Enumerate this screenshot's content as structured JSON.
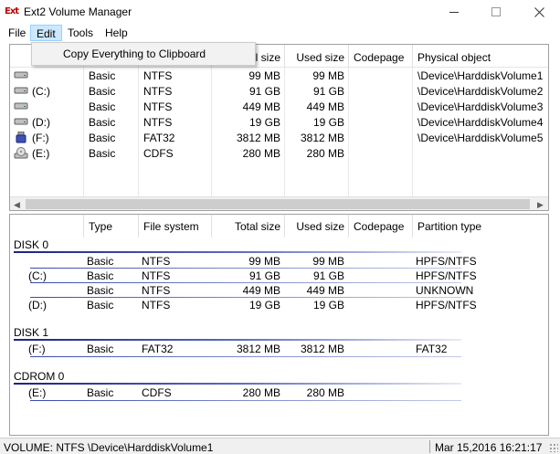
{
  "window": {
    "title": "Ext2 Volume Manager",
    "icon_text": "Ext"
  },
  "menu": {
    "file": "File",
    "edit": "Edit",
    "tools": "Tools",
    "help": "Help"
  },
  "dropdown": {
    "item": "Copy Everything to Clipboard"
  },
  "top_table": {
    "headers": {
      "total_size": "Total size",
      "used_size": "Used size",
      "codepage": "Codepage",
      "physical_object": "Physical object"
    },
    "rows": [
      {
        "icon": "hard-drive-icon",
        "name": "",
        "type": "Basic",
        "fs": "NTFS",
        "total": "99 MB",
        "used": "99 MB",
        "codepage": "",
        "physical": "\\Device\\HarddiskVolume1"
      },
      {
        "icon": "hard-drive-icon",
        "name": "(C:)",
        "type": "Basic",
        "fs": "NTFS",
        "total": "91 GB",
        "used": "91 GB",
        "codepage": "",
        "physical": "\\Device\\HarddiskVolume2"
      },
      {
        "icon": "hard-drive-icon",
        "name": "",
        "type": "Basic",
        "fs": "NTFS",
        "total": "449 MB",
        "used": "449 MB",
        "codepage": "",
        "physical": "\\Device\\HarddiskVolume3"
      },
      {
        "icon": "hard-drive-icon",
        "name": "(D:)",
        "type": "Basic",
        "fs": "NTFS",
        "total": "19 GB",
        "used": "19 GB",
        "codepage": "",
        "physical": "\\Device\\HarddiskVolume4"
      },
      {
        "icon": "usb-drive-icon",
        "name": "(F:)",
        "type": "Basic",
        "fs": "FAT32",
        "total": "3812 MB",
        "used": "3812 MB",
        "codepage": "",
        "physical": "\\Device\\HarddiskVolume5"
      },
      {
        "icon": "cdrom-drive-icon",
        "name": "(E:)",
        "type": "Basic",
        "fs": "CDFS",
        "total": "280 MB",
        "used": "280 MB",
        "codepage": "",
        "physical": ""
      }
    ]
  },
  "bottom_table": {
    "headers": {
      "type": "Type",
      "file_system": "File system",
      "total_size": "Total size",
      "used_size": "Used size",
      "codepage": "Codepage",
      "partition_type": "Partition type"
    },
    "disk0": {
      "label": "DISK 0",
      "rows": [
        {
          "name": "",
          "type": "Basic",
          "fs": "NTFS",
          "total": "99 MB",
          "used": "99 MB",
          "ptype": "HPFS/NTFS"
        },
        {
          "name": "(C:)",
          "type": "Basic",
          "fs": "NTFS",
          "total": "91 GB",
          "used": "91 GB",
          "ptype": "HPFS/NTFS"
        },
        {
          "name": "",
          "type": "Basic",
          "fs": "NTFS",
          "total": "449 MB",
          "used": "449 MB",
          "ptype": "UNKNOWN"
        },
        {
          "name": "(D:)",
          "type": "Basic",
          "fs": "NTFS",
          "total": "19 GB",
          "used": "19 GB",
          "ptype": "HPFS/NTFS"
        }
      ]
    },
    "disk1": {
      "label": "DISK 1",
      "rows": [
        {
          "name": "(F:)",
          "type": "Basic",
          "fs": "FAT32",
          "total": "3812 MB",
          "used": "3812 MB",
          "ptype": "FAT32"
        }
      ]
    },
    "cdrom0": {
      "label": "CDROM 0",
      "rows": [
        {
          "name": "(E:)",
          "type": "Basic",
          "fs": "CDFS",
          "total": "280 MB",
          "used": "280 MB",
          "ptype": ""
        }
      ]
    }
  },
  "status": {
    "left": "VOLUME:  NTFS \\Device\\HarddiskVolume1",
    "right": "Mar 15,2016 16:21:17"
  },
  "colors": {
    "menu_highlight": "#cce8ff",
    "group_line": "#1a237e"
  }
}
